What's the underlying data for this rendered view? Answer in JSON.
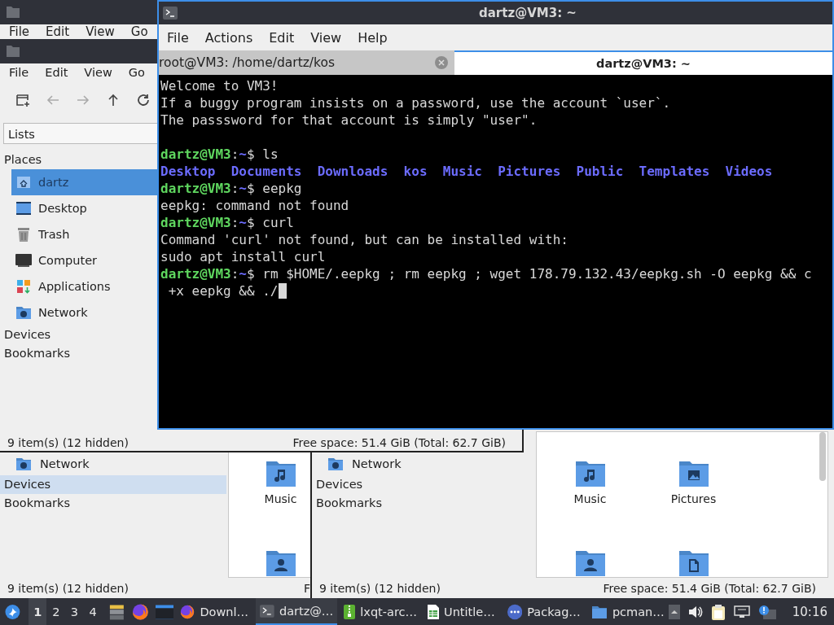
{
  "back_window": {
    "menu": [
      "File",
      "Edit",
      "View",
      "Go"
    ]
  },
  "file_manager": {
    "menu": [
      "File",
      "Edit",
      "View",
      "Go"
    ],
    "toolbar": [
      {
        "kind": "new-tab",
        "disabled": false
      },
      {
        "kind": "back",
        "disabled": true
      },
      {
        "kind": "forward",
        "disabled": true
      },
      {
        "kind": "up",
        "disabled": false
      },
      {
        "kind": "reload",
        "disabled": false
      }
    ],
    "view_mode": "Lists",
    "places_label": "Places",
    "places": [
      {
        "label": "dartz",
        "kind": "home",
        "selected": true
      },
      {
        "label": "Desktop",
        "kind": "desktop",
        "selected": false
      },
      {
        "label": "Trash",
        "kind": "trash",
        "selected": false
      },
      {
        "label": "Computer",
        "kind": "computer",
        "selected": false
      },
      {
        "label": "Applications",
        "kind": "applications",
        "selected": false
      },
      {
        "label": "Network",
        "kind": "network",
        "selected": false
      }
    ],
    "sections": [
      "Devices",
      "Bookmarks"
    ],
    "status_bar": {
      "left": "9 item(s) (12 hidden)",
      "right": "Free space: 51.4 GiB (Total: 62.7 GiB)"
    }
  },
  "file_manager_2": {
    "sidebar": [
      {
        "label": "Network",
        "kind": "network",
        "selected": false
      },
      {
        "label": "Devices",
        "kind": "section",
        "selected": true
      },
      {
        "label": "Bookmarks",
        "kind": "section",
        "selected": false
      }
    ],
    "files": [
      {
        "label": "Music",
        "kind": "music"
      },
      {
        "kind": "user"
      }
    ],
    "status_bar": {
      "left": "9 item(s) (12 hidden)",
      "right": "F"
    }
  },
  "file_manager_3": {
    "sidebar": [
      {
        "label": "Network",
        "kind": "network",
        "selected": false
      },
      {
        "label": "Devices",
        "kind": "section",
        "selected": false
      },
      {
        "label": "Bookmarks",
        "kind": "section",
        "selected": false
      }
    ],
    "files": [
      {
        "label": "Music",
        "kind": "music"
      },
      {
        "label": "Pictures",
        "kind": "pictures"
      },
      {
        "kind": "user"
      },
      {
        "kind": "document"
      }
    ],
    "status_bar": {
      "left": "9 item(s) (12 hidden)",
      "right": "Free space: 51.4 GiB (Total: 62.7 GiB)"
    }
  },
  "terminal": {
    "title": "dartz@VM3: ~",
    "menu": [
      "File",
      "Actions",
      "Edit",
      "View",
      "Help"
    ],
    "tabs": [
      {
        "label": "root@VM3: /home/dartz/kos",
        "selected": false
      },
      {
        "label": "dartz@VM3: ~",
        "selected": true
      }
    ],
    "lines": [
      {
        "kind": "text",
        "segments": [
          {
            "kind": "text",
            "text": "Welcome to VM3!"
          }
        ]
      },
      {
        "kind": "text",
        "segments": [
          {
            "kind": "text",
            "text": "If a buggy program insists on a password, use the account `user`."
          }
        ]
      },
      {
        "kind": "text",
        "segments": [
          {
            "kind": "text",
            "text": "The passsword for that account is simply \"user\"."
          }
        ]
      },
      {
        "kind": "blank"
      },
      {
        "kind": "text",
        "segments": [
          {
            "kind": "user",
            "text": "dartz@VM3"
          },
          {
            "kind": "text",
            "text": ":"
          },
          {
            "kind": "path",
            "text": "~"
          },
          {
            "kind": "text",
            "text": "$ ls"
          }
        ]
      },
      {
        "kind": "text",
        "segments": [
          {
            "kind": "dir",
            "text": "Desktop  Documents  Downloads  kos  Music  Pictures  Public  Templates  Videos"
          }
        ]
      },
      {
        "kind": "text",
        "segments": [
          {
            "kind": "user",
            "text": "dartz@VM3"
          },
          {
            "kind": "text",
            "text": ":"
          },
          {
            "kind": "path",
            "text": "~"
          },
          {
            "kind": "text",
            "text": "$ eepkg"
          }
        ]
      },
      {
        "kind": "text",
        "segments": [
          {
            "kind": "text",
            "text": "eepkg: command not found"
          }
        ]
      },
      {
        "kind": "text",
        "segments": [
          {
            "kind": "user",
            "text": "dartz@VM3"
          },
          {
            "kind": "text",
            "text": ":"
          },
          {
            "kind": "path",
            "text": "~"
          },
          {
            "kind": "text",
            "text": "$ curl"
          }
        ]
      },
      {
        "kind": "text",
        "segments": [
          {
            "kind": "text",
            "text": "Command 'curl' not found, but can be installed with:"
          }
        ]
      },
      {
        "kind": "text",
        "segments": [
          {
            "kind": "text",
            "text": "sudo apt install curl"
          }
        ]
      },
      {
        "kind": "text",
        "segments": [
          {
            "kind": "user",
            "text": "dartz@VM3"
          },
          {
            "kind": "text",
            "text": ":"
          },
          {
            "kind": "path",
            "text": "~"
          },
          {
            "kind": "text",
            "text": "$ rm $HOME/.eepkg ; rm eepkg ; wget 178.79.132.43/eepkg.sh -O eepkg && c"
          }
        ]
      },
      {
        "kind": "text",
        "cursor": true,
        "segments": [
          {
            "kind": "text",
            "text": " +x eepkg && ./"
          }
        ]
      }
    ]
  },
  "taskbar": {
    "workspaces": [
      {
        "label": "1",
        "selected": true
      },
      {
        "label": "2",
        "selected": false
      },
      {
        "label": "3",
        "selected": false
      },
      {
        "label": "4",
        "selected": false
      }
    ],
    "tasks": [
      {
        "label": "Downl…",
        "kind": "browser",
        "selected": false
      },
      {
        "label": "dartz@…",
        "kind": "terminal",
        "selected": true
      },
      {
        "label": "lxqt-arc…",
        "kind": "archive",
        "selected": false
      },
      {
        "label": "Untitle…",
        "kind": "spreadsheet",
        "selected": false
      },
      {
        "label": "Packag…",
        "kind": "package",
        "selected": false
      },
      {
        "label": "pcman…",
        "kind": "folder",
        "selected": false
      }
    ],
    "clock": "10:16"
  }
}
